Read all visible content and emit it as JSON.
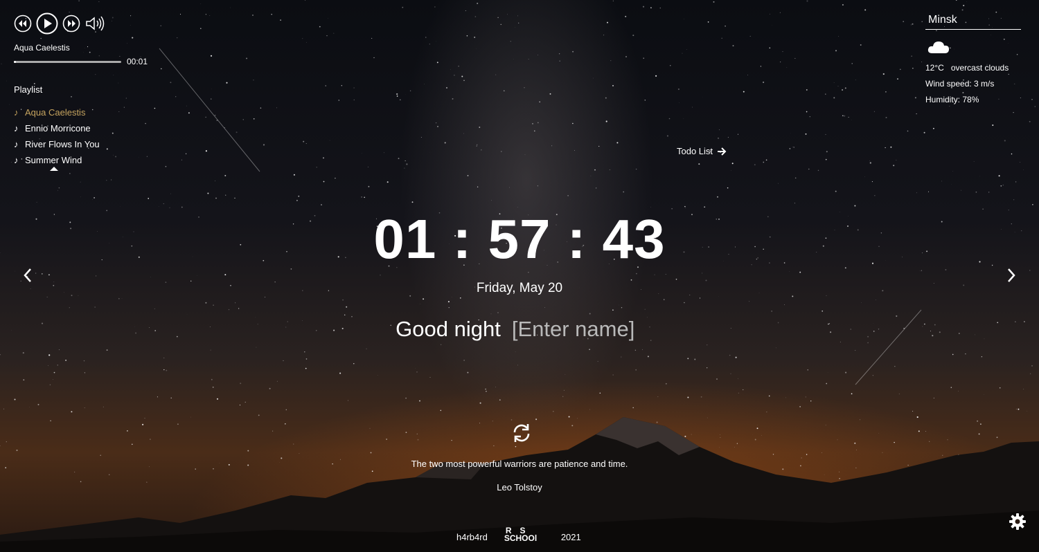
{
  "player": {
    "current_track": "Aqua Caelestis",
    "current_time": "00:01",
    "progress_fraction": 0.02,
    "playlist_label": "Playlist",
    "playlist": [
      {
        "title": "Aqua Caelestis",
        "active": true
      },
      {
        "title": "Ennio Morricone",
        "active": false
      },
      {
        "title": "River Flows In You",
        "active": false
      },
      {
        "title": "Summer Wind",
        "active": false
      }
    ],
    "note_symbol": "♪",
    "icons": [
      "rewind-icon",
      "play-icon",
      "forward-icon",
      "volume-icon",
      "music-note-icon"
    ]
  },
  "weather": {
    "city": "Minsk",
    "icon": "cloud-icon",
    "temperature": "12°C",
    "description": "overcast clouds",
    "wind": "Wind speed: 3 m/s",
    "humidity": "Humidity: 78%"
  },
  "todo": {
    "label": "Todo List",
    "icon": "arrow-right-icon"
  },
  "clock": {
    "time": "01 : 57 : 43",
    "date": "Friday, May 20"
  },
  "greeting": {
    "text": "Good night",
    "name_placeholder": "[Enter name]"
  },
  "quote": {
    "text": "The two most powerful warriors are patience and time.",
    "author": "Leo Tolstoy"
  },
  "footer": {
    "github": "h4rb4rd",
    "logo_top": "RS",
    "logo_bottom": "SCHOOl",
    "year": "2021"
  },
  "colors": {
    "active_track": "#c6a45f",
    "text": "#ffffff",
    "placeholder": "#b9b9b9"
  }
}
